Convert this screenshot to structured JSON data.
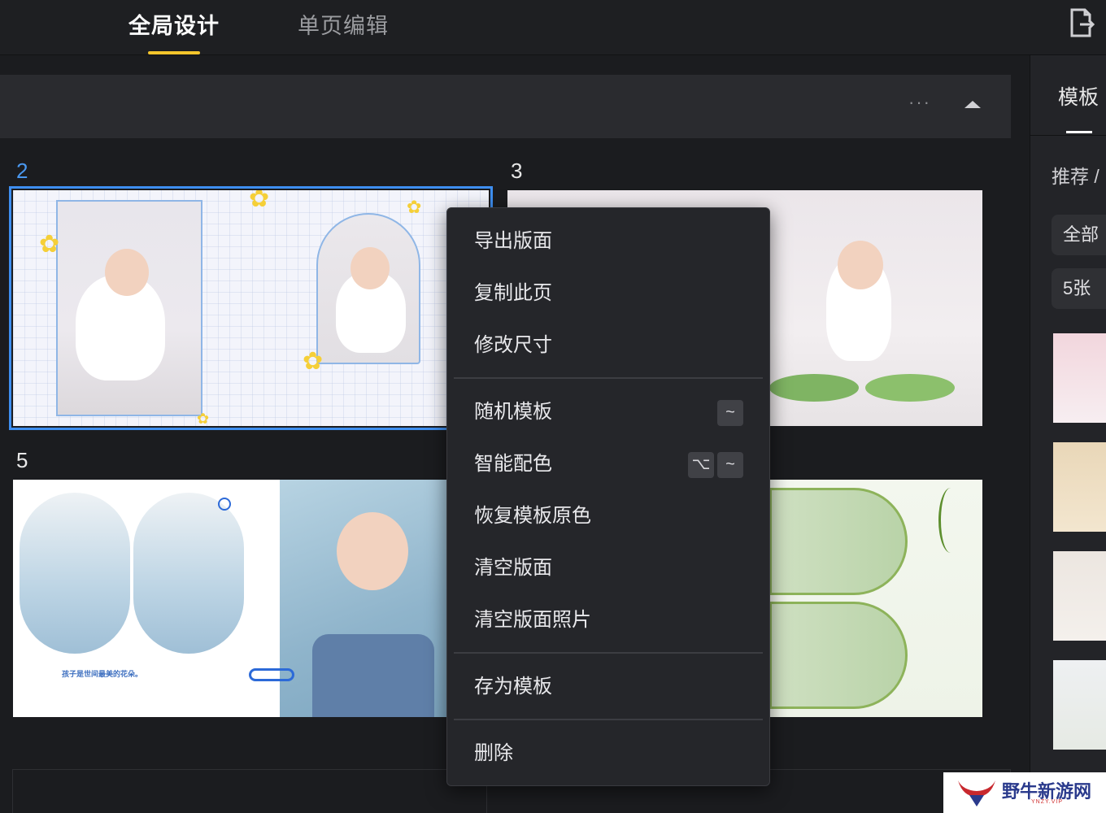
{
  "header": {
    "tabs": [
      {
        "label": "全局设计",
        "active": true
      },
      {
        "label": "单页编辑",
        "active": false
      }
    ],
    "accent_color": "#f5c52c",
    "export_icon": "export-page-icon"
  },
  "canvas": {
    "more_icon": "···",
    "spreads": [
      {
        "number": "2",
        "selected": true
      },
      {
        "number": "3",
        "selected": false
      },
      {
        "number": "5",
        "selected": false
      }
    ],
    "spread5_caption": "孩子是世间最美的花朵。"
  },
  "context_menu": {
    "items": [
      {
        "label": "导出版面"
      },
      {
        "label": "复制此页"
      },
      {
        "label": "修改尺寸"
      },
      {
        "label": "随机模板",
        "shortcut": [
          "~"
        ]
      },
      {
        "label": "智能配色",
        "shortcut": [
          "⌥",
          "~"
        ]
      },
      {
        "label": "恢复模板原色"
      },
      {
        "label": "清空版面"
      },
      {
        "label": "清空版面照片"
      },
      {
        "label": "存为模板"
      },
      {
        "label": "删除"
      }
    ]
  },
  "right_panel": {
    "title": "模板",
    "breadcrumb": "推荐 /",
    "filters": [
      "全部",
      "5张"
    ]
  },
  "watermark": {
    "text": "野牛新游网",
    "sub": "YNZY.VIP"
  },
  "colors": {
    "selection": "#3e8ef0",
    "page_number_active": "#4a98f0",
    "flower": "#f5cf38"
  }
}
